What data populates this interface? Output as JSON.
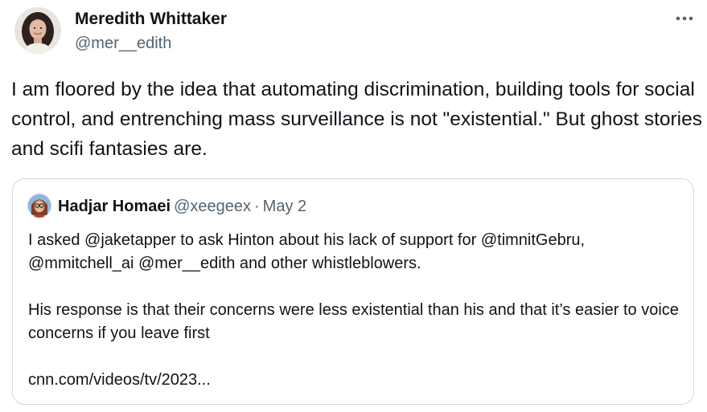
{
  "author": {
    "display_name": "Meredith Whittaker",
    "handle": "@mer__edith",
    "avatar_icon": "profile-photo"
  },
  "more_icon": "ellipsis-horizontal-icon",
  "tweet": {
    "text": "I am floored by the idea that automating discrimination, building tools for social control, and entrenching mass surveillance is not \"existential.\" But ghost stories and scifi fantasies are."
  },
  "quoted_tweet": {
    "display_name": "Hadjar Homaei",
    "handle": "@xeegeex",
    "separator": "·",
    "date": "May 2",
    "paragraph_1": "I asked @jaketapper to ask Hinton about his lack of support for @timnitGebru, @mmitchell_ai @mer__edith and other whistleblowers.",
    "paragraph_2": "His response is that their concerns were less existential than his and that it’s easier to voice concerns if you leave first",
    "link": "cnn.com/videos/tv/2023..."
  },
  "colors": {
    "text_primary": "#0f1419",
    "text_secondary": "#536471",
    "border": "#cfd9de"
  }
}
